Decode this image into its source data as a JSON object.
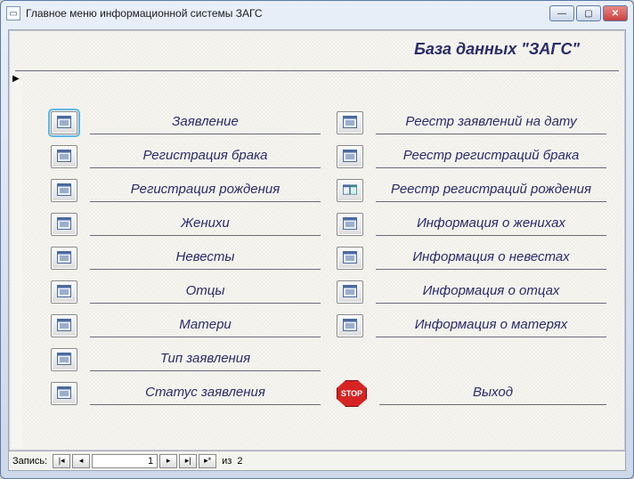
{
  "window": {
    "title": "Главное меню информационной системы ЗАГС"
  },
  "header": {
    "title": "База данных \"ЗАГС\""
  },
  "menu": {
    "left": [
      {
        "label": "Заявление",
        "icon": "form"
      },
      {
        "label": "Регистрация брака",
        "icon": "form"
      },
      {
        "label": "Регистрация рождения",
        "icon": "form"
      },
      {
        "label": "Женихи",
        "icon": "form"
      },
      {
        "label": "Невесты",
        "icon": "form"
      },
      {
        "label": "Отцы",
        "icon": "form"
      },
      {
        "label": "Матери",
        "icon": "form"
      },
      {
        "label": "Тип заявления",
        "icon": "form"
      },
      {
        "label": "Статус заявления",
        "icon": "form"
      }
    ],
    "right": [
      {
        "label": "Реестр заявлений на дату",
        "icon": "report"
      },
      {
        "label": "Реестр регистраций брака",
        "icon": "report"
      },
      {
        "label": "Реестр регистраций рождения",
        "icon": "report2"
      },
      {
        "label": "Информация о женихах",
        "icon": "form"
      },
      {
        "label": "Информация о невестах",
        "icon": "form"
      },
      {
        "label": "Информация о отцах",
        "icon": "form"
      },
      {
        "label": "Информация о матерях",
        "icon": "form"
      },
      {
        "label": "",
        "icon": "none"
      },
      {
        "label": "Выход",
        "icon": "stop"
      }
    ]
  },
  "nav": {
    "record_label": "Запись:",
    "current": "1",
    "of": "из",
    "total": "2"
  },
  "icons": {
    "stop_text": "STOP"
  }
}
